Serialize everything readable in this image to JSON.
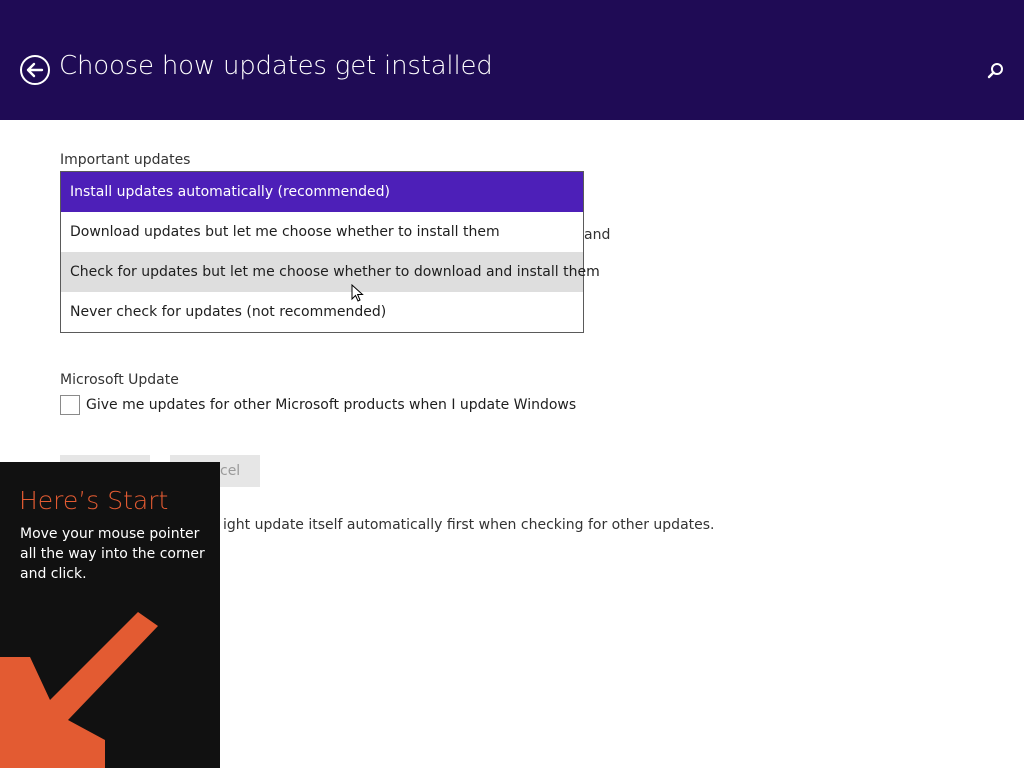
{
  "header": {
    "title": "Choose how updates get installed"
  },
  "important_updates": {
    "label": "Important updates",
    "background_text_right": "and",
    "dropdown": {
      "options": [
        "Install updates automatically (recommended)",
        "Download updates but let me choose whether to install them",
        "Check for updates but let me choose whether to download and install them",
        "Never check for updates (not recommended)"
      ],
      "selected_index": 0,
      "hover_index": 2
    }
  },
  "microsoft_update": {
    "label": "Microsoft Update",
    "checkbox_label": "Give me updates for other Microsoft products when I update Windows",
    "checked": false
  },
  "buttons": {
    "cancel_partial": "cel"
  },
  "footnote_partial": "ight update itself automatically first when checking for other updates.",
  "tip": {
    "title": "Here’s Start",
    "text": "Move your mouse pointer all the way into the corner and click."
  },
  "colors": {
    "header_bg": "#1f0b55",
    "selected_option": "#4d1fb8",
    "tip_accent": "#e35b32"
  }
}
